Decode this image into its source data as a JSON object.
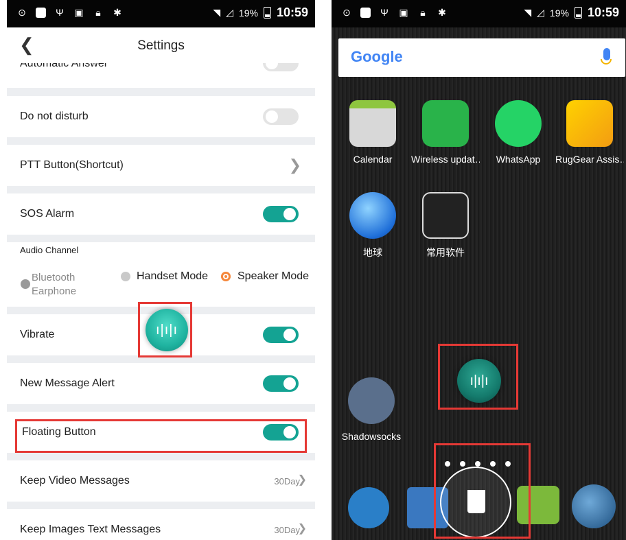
{
  "left": {
    "status": {
      "battery": "19%",
      "time": "10:59"
    },
    "title": "Settings",
    "rows": [
      {
        "label": "Automatic Answer",
        "toggle": false
      },
      {
        "label": "Do not disturb",
        "toggle": false
      },
      {
        "label": "PTT Button(Shortcut)"
      },
      {
        "label": "SOS Alarm",
        "toggle": true
      },
      {
        "label": "Vibrate",
        "toggle": true
      },
      {
        "label": "New Message Alert",
        "toggle": true
      },
      {
        "label": "Floating Button",
        "toggle": true
      },
      {
        "label": "Keep Video Messages",
        "value": "30Day"
      },
      {
        "label": "Keep Images Text Messages",
        "value": "30Day"
      }
    ],
    "audio": {
      "header": "Audio Channel",
      "options": [
        {
          "label": "Bluetooth Earphone",
          "state": "disabled"
        },
        {
          "label": "Handset Mode",
          "state": "unselected"
        },
        {
          "label": "Speaker Mode",
          "state": "selected"
        }
      ]
    }
  },
  "right": {
    "status": {
      "battery": "19%",
      "time": "10:59"
    },
    "search": {
      "logo": "Google"
    },
    "apps": [
      {
        "label": "Calendar",
        "icon": "calendar-icon"
      },
      {
        "label": "Wireless updat…",
        "icon": "wireless-update-icon"
      },
      {
        "label": "WhatsApp",
        "icon": "whatsapp-icon"
      },
      {
        "label": "RugGear Assis…",
        "icon": "runner-icon"
      },
      {
        "label": "地球",
        "icon": "earth-icon"
      },
      {
        "label": "常用软件",
        "icon": "folder-icon"
      },
      {
        "label": "Shadowsocks",
        "icon": "paper-plane-icon"
      }
    ]
  },
  "colors": {
    "toggle_on": "#14a393",
    "highlight": "#e53935",
    "selected_radio": "#f5873b"
  }
}
